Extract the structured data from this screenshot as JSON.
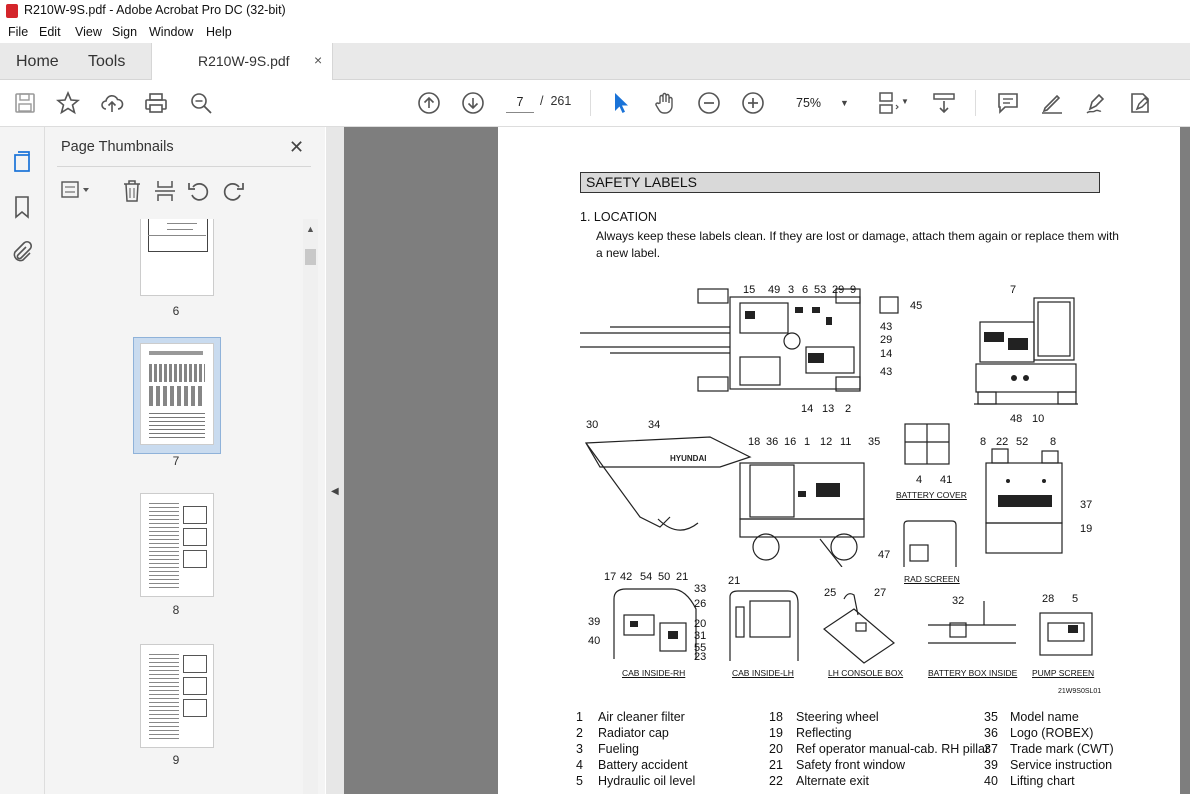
{
  "window": {
    "title": "R210W-9S.pdf - Adobe Acrobat Pro DC (32-bit)"
  },
  "menu": [
    "File",
    "Edit",
    "View",
    "Sign",
    "Window",
    "Help"
  ],
  "tabs": {
    "home": "Home",
    "tools": "Tools",
    "document": "R210W-9S.pdf",
    "close": "×"
  },
  "toolbar": {
    "page_current": "7",
    "page_sep": "/",
    "page_total": "261",
    "zoom": "75%"
  },
  "thumbnails": {
    "title": "Page Thumbnails",
    "pages": [
      {
        "label": "6"
      },
      {
        "label": "7",
        "selected": true
      },
      {
        "label": "8"
      },
      {
        "label": "9"
      }
    ]
  },
  "doc": {
    "section_title": "SAFETY LABELS",
    "location_heading": "1.  LOCATION",
    "instruction_1": "Always keep these labels clean.  If they are lost or damage, attach them again or replace them with",
    "instruction_2": "a new label.",
    "captions": {
      "battery_cover": "BATTERY COVER",
      "rad_screen": "RAD SCREEN",
      "cab_inside_rh": "CAB INSIDE-RH",
      "cab_inside_lh": "CAB INSIDE-LH",
      "lh_console_box": "LH CONSOLE BOX",
      "battery_box_inside": "BATTERY BOX INSIDE",
      "pump_screen": "PUMP SCREEN",
      "figure_code": "21W9S0SL01"
    },
    "brand_on_machine": "HYUNDAI",
    "top_view_callouts": [
      "15",
      "49",
      "3",
      "6",
      "53",
      "29",
      "9",
      "45",
      "43",
      "29",
      "14",
      "43",
      "14",
      "13",
      "2"
    ],
    "rear_view_callouts": [
      "7",
      "48",
      "10"
    ],
    "side_view_callouts": [
      "30",
      "34",
      "18",
      "36",
      "16",
      "1",
      "12",
      "11",
      "35"
    ],
    "battery_callouts": [
      "4",
      "41"
    ],
    "rear2_callouts": [
      "8",
      "22",
      "52",
      "8",
      "37",
      "19"
    ],
    "rad_callouts": [
      "47"
    ],
    "cab_rh_callouts": [
      "17",
      "42",
      "54",
      "50",
      "21",
      "33",
      "26",
      "39",
      "40",
      "20",
      "31",
      "55",
      "23"
    ],
    "cab_lh_callouts": [
      "21"
    ],
    "console_callouts": [
      "25",
      "27"
    ],
    "batbox_callouts": [
      "32"
    ],
    "pump_callouts": [
      "28",
      "5"
    ],
    "legend": [
      {
        "n": "1",
        "t": "Air cleaner filter"
      },
      {
        "n": "2",
        "t": "Radiator cap"
      },
      {
        "n": "3",
        "t": "Fueling"
      },
      {
        "n": "4",
        "t": "Battery accident"
      },
      {
        "n": "5",
        "t": "Hydraulic oil level"
      },
      {
        "n": "18",
        "t": "Steering wheel"
      },
      {
        "n": "19",
        "t": "Reflecting"
      },
      {
        "n": "20",
        "t": "Ref operator manual-cab. RH pillar"
      },
      {
        "n": "21",
        "t": "Safety front window"
      },
      {
        "n": "22",
        "t": "Alternate exit"
      },
      {
        "n": "35",
        "t": "Model name"
      },
      {
        "n": "36",
        "t": "Logo (ROBEX)"
      },
      {
        "n": "37",
        "t": "Trade mark (CWT)"
      },
      {
        "n": "39",
        "t": "Service instruction"
      },
      {
        "n": "40",
        "t": "Lifting chart"
      }
    ]
  }
}
